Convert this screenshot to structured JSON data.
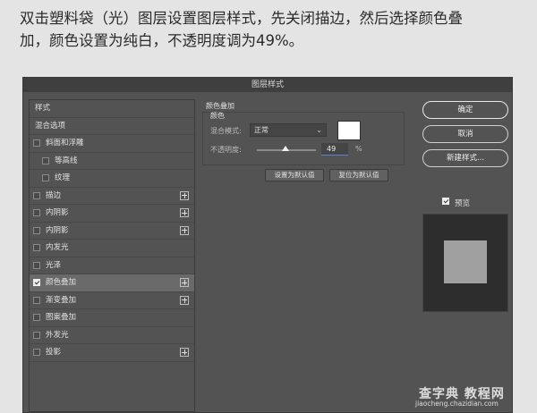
{
  "caption": {
    "line1": "双击塑料袋（光）图层设置图层样式，先关闭描边，然后选择颜色叠",
    "line2": "加，颜色设置为纯白，不透明度调为49%。"
  },
  "dialog": {
    "title": "图层样式",
    "styles_list": {
      "header_items": [
        "样式",
        "混合选项"
      ],
      "items": [
        {
          "label": "斜面和浮雕",
          "checked": false,
          "has_plus": false,
          "sub": false
        },
        {
          "label": "等高线",
          "checked": false,
          "has_plus": false,
          "sub": true
        },
        {
          "label": "纹理",
          "checked": false,
          "has_plus": false,
          "sub": true
        },
        {
          "label": "描边",
          "checked": false,
          "has_plus": true,
          "sub": false
        },
        {
          "label": "内阴影",
          "checked": false,
          "has_plus": true,
          "sub": false
        },
        {
          "label": "内阴影",
          "checked": false,
          "has_plus": true,
          "sub": false
        },
        {
          "label": "内发光",
          "checked": false,
          "has_plus": false,
          "sub": false
        },
        {
          "label": "光泽",
          "checked": false,
          "has_plus": false,
          "sub": false
        },
        {
          "label": "颜色叠加",
          "checked": true,
          "has_plus": true,
          "sub": false,
          "selected": true
        },
        {
          "label": "渐变叠加",
          "checked": false,
          "has_plus": true,
          "sub": false
        },
        {
          "label": "图案叠加",
          "checked": false,
          "has_plus": false,
          "sub": false
        },
        {
          "label": "外发光",
          "checked": false,
          "has_plus": false,
          "sub": false
        },
        {
          "label": "投影",
          "checked": false,
          "has_plus": true,
          "sub": false
        }
      ]
    },
    "color_overlay": {
      "section_title": "颜色叠加",
      "group_title": "颜色",
      "blend_mode_label": "混合模式:",
      "blend_mode_value": "正常",
      "swatch_color": "#ffffff",
      "opacity_label": "不透明度:",
      "opacity_value": "49",
      "opacity_unit": "%",
      "opacity_fraction": 0.49,
      "make_default_label": "设置为默认值",
      "reset_default_label": "复位为默认值"
    },
    "buttons": {
      "ok": "确定",
      "cancel": "取消",
      "new_style": "新建样式..."
    },
    "preview": {
      "label": "预览",
      "checked": true
    }
  },
  "watermark": {
    "brand": "查字典 教程网",
    "url": "jiaocheng.chazidian.com"
  },
  "colors": {
    "dialog_bg": "#535353",
    "selected_row": "#6a6a6a",
    "accent_underline": "#4f87d6"
  }
}
